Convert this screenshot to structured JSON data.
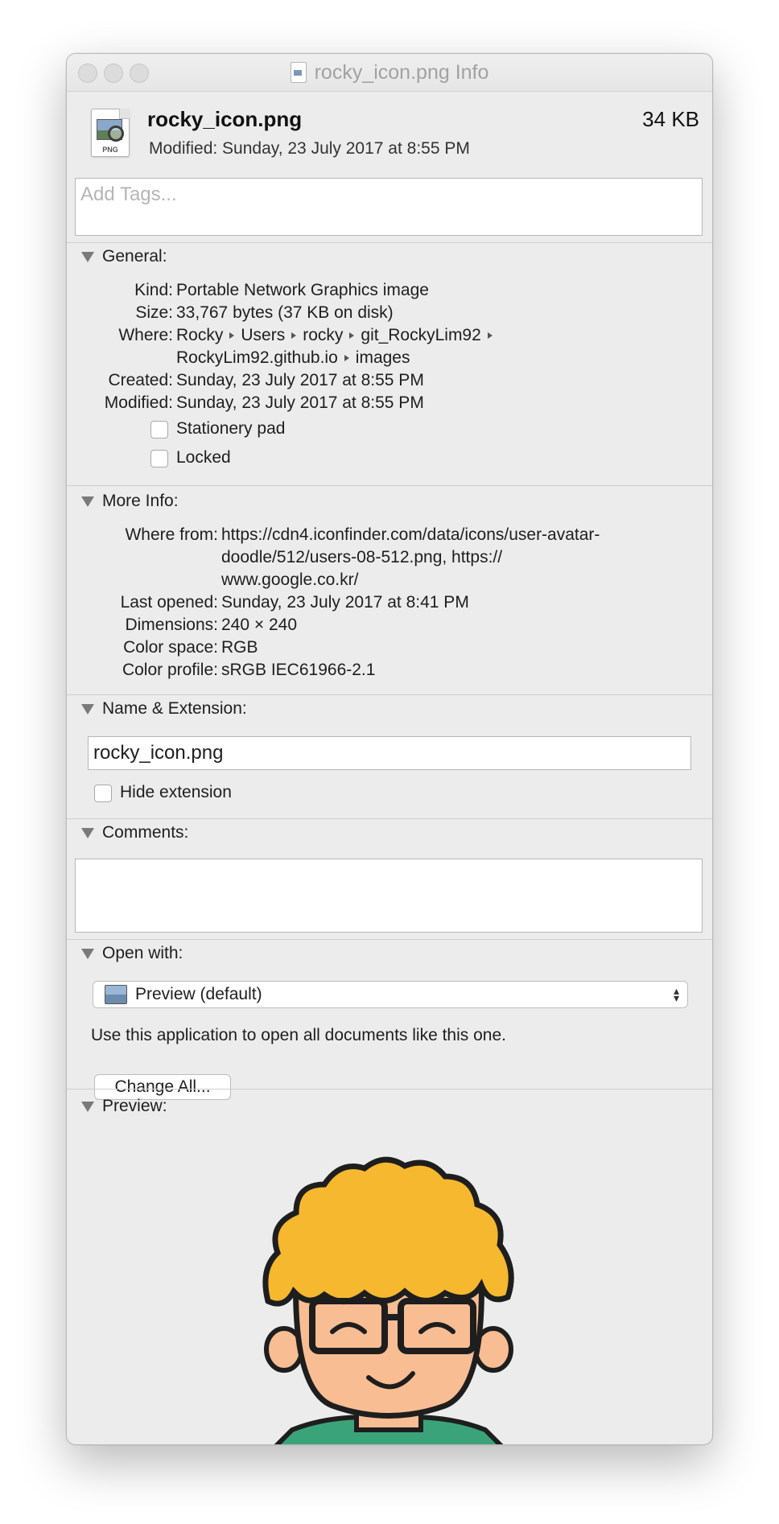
{
  "window": {
    "title": "rocky_icon.png Info"
  },
  "header": {
    "name": "rocky_icon.png",
    "size": "34 KB",
    "modified": "Modified: Sunday, 23 July 2017 at 8:55 PM",
    "icon_tag": "PNG"
  },
  "tags": {
    "placeholder": "Add Tags..."
  },
  "general": {
    "heading": "General:",
    "kind_label": "Kind:",
    "kind": "Portable Network Graphics image",
    "size_label": "Size:",
    "size": "33,767 bytes (37 KB on disk)",
    "where_label": "Where:",
    "path": [
      "Rocky",
      "Users",
      "rocky",
      "git_RockyLim92",
      "RockyLim92.github.io",
      "images"
    ],
    "created_label": "Created:",
    "created": "Sunday, 23 July 2017 at 8:55 PM",
    "modified_label": "Modified:",
    "modified": "Sunday, 23 July 2017 at 8:55 PM",
    "stationery": "Stationery pad",
    "locked": "Locked"
  },
  "more_info": {
    "heading": "More Info:",
    "where_from_label": "Where from:",
    "where_from_lines": [
      "https://cdn4.iconfinder.com/data/icons/user-avatar-",
      "doodle/512/users-08-512.png, https://",
      "www.google.co.kr/"
    ],
    "last_opened_label": "Last opened:",
    "last_opened": "Sunday, 23 July 2017 at 8:41 PM",
    "dimensions_label": "Dimensions:",
    "dimensions": "240 × 240",
    "color_space_label": "Color space:",
    "color_space": "RGB",
    "color_profile_label": "Color profile:",
    "color_profile": "sRGB IEC61966-2.1"
  },
  "name_ext": {
    "heading": "Name & Extension:",
    "value": "rocky_icon.png",
    "hide_extension": "Hide extension"
  },
  "comments": {
    "heading": "Comments:"
  },
  "open_with": {
    "heading": "Open with:",
    "app": "Preview (default)",
    "note": "Use this application to open all documents like this one.",
    "button": "Change All..."
  },
  "preview": {
    "heading": "Preview:"
  },
  "colors": {
    "window_bg": "#ececec",
    "hair": "#f5b82e",
    "skin": "#f8bd93",
    "shirt": "#3aa37a",
    "outline": "#1e1e1e"
  }
}
